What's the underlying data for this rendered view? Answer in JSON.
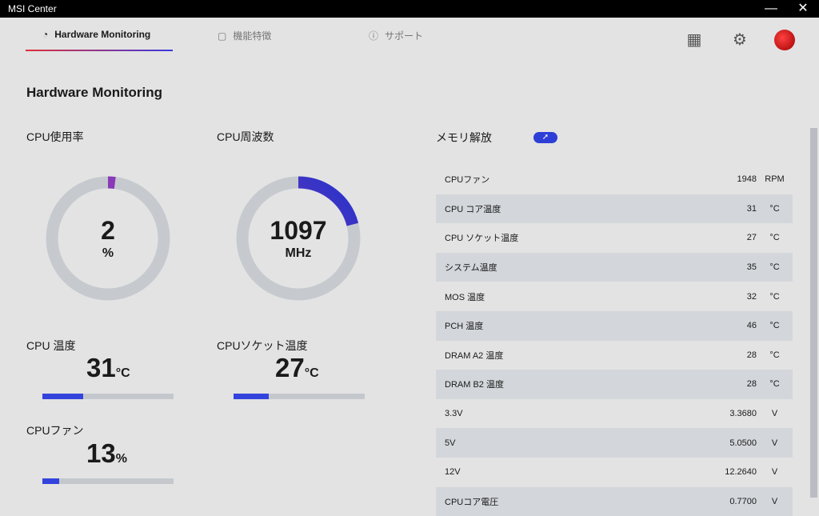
{
  "window": {
    "title": "MSI Center",
    "minimize": "—",
    "close": "✕"
  },
  "tabs": [
    {
      "label": "Hardware Monitoring",
      "icon": "gauge-icon"
    },
    {
      "label": "機能特徴",
      "icon": "feature-icon"
    },
    {
      "label": "サポート",
      "icon": "support-icon"
    }
  ],
  "page_title": "Hardware Monitoring",
  "cpu_usage": {
    "label": "CPU使用率",
    "value": "2",
    "unit": "%",
    "fraction": 0.02
  },
  "cpu_freq": {
    "label": "CPU周波数",
    "value": "1097",
    "unit": "MHz",
    "fraction": 0.21
  },
  "cpu_temp": {
    "label": "CPU 温度",
    "value": "31",
    "unit": "°C",
    "fraction": 0.31
  },
  "socket_temp": {
    "label": "CPUソケット温度",
    "value": "27",
    "unit": "°C",
    "fraction": 0.27
  },
  "cpu_fan": {
    "label": "CPUファン",
    "value": "13",
    "unit": "%",
    "fraction": 0.13
  },
  "memory": {
    "label": "メモリ解放",
    "button": "➚"
  },
  "sensors": [
    {
      "name": "CPUファン",
      "value": "1948",
      "unit": "RPM"
    },
    {
      "name": "CPU コア温度",
      "value": "31",
      "unit": "°C"
    },
    {
      "name": "CPU ソケット温度",
      "value": "27",
      "unit": "°C"
    },
    {
      "name": "システム温度",
      "value": "35",
      "unit": "°C"
    },
    {
      "name": "MOS 温度",
      "value": "32",
      "unit": "°C"
    },
    {
      "name": "PCH 温度",
      "value": "46",
      "unit": "°C"
    },
    {
      "name": "DRAM A2 温度",
      "value": "28",
      "unit": "°C"
    },
    {
      "name": "DRAM B2 温度",
      "value": "28",
      "unit": "°C"
    },
    {
      "name": "3.3V",
      "value": "3.3680",
      "unit": "V"
    },
    {
      "name": "5V",
      "value": "5.0500",
      "unit": "V"
    },
    {
      "name": "12V",
      "value": "12.2640",
      "unit": "V"
    },
    {
      "name": "CPUコア電圧",
      "value": "0.7700",
      "unit": "V"
    }
  ]
}
